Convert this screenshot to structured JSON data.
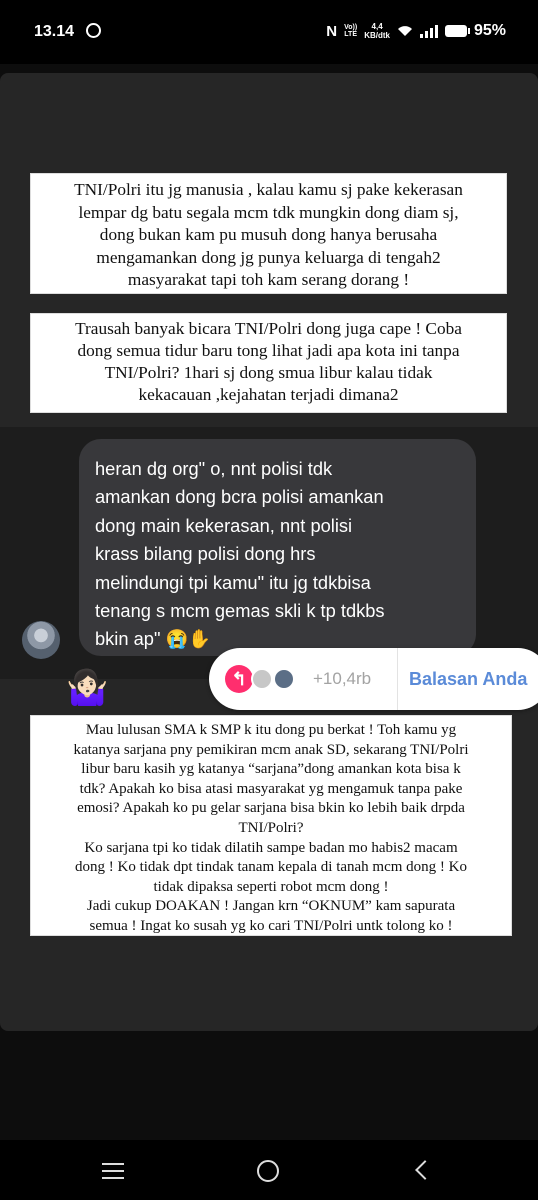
{
  "status": {
    "time": "13.14",
    "net_top": "Vo))",
    "net_bottom": "LTE",
    "speed_top": "4,4",
    "speed_bottom": "KB/dtk",
    "battery": "95%"
  },
  "quote1": {
    "lines": [
      "TNI/Polri itu jg manusia , kalau kamu sj pake kekerasan",
      "lempar dg batu segala mcm tdk mungkin dong diam sj,",
      "dong bukan kam pu musuh dong hanya berusaha",
      "mengamankan dong jg punya keluarga di tengah2",
      "masyarakat tapi toh kam serang dorang !"
    ]
  },
  "quote2": {
    "lines": [
      "Trausah banyak bicara TNI/Polri dong juga cape ! Coba",
      "dong semua tidur baru tong lihat jadi apa kota ini tanpa",
      "TNI/Polri? 1hari sj dong smua libur kalau tidak",
      "kekacauan ,kejahatan terjadi dimana2"
    ]
  },
  "message": {
    "lines": [
      "heran dg org\" o, nnt polisi tdk",
      "amankan dong bcra polisi amankan",
      "dong main kekerasan, nnt polisi",
      "krass bilang polisi dong hrs",
      "melindungi tpi kamu\" itu jg tdkbisa",
      "tenang s mcm gemas skli k tp tdkbs",
      "bkin ap\" 😭✋"
    ]
  },
  "reaction_emoji": "🤷🏻‍♀️",
  "reply_bar": {
    "arrow": "↰",
    "count": "+10,4rb",
    "label": "Balasan Anda"
  },
  "quote3": {
    "lines": [
      "Mau lulusan SMA k SMP k itu dong pu berkat ! Toh kamu yg",
      "katanya sarjana pny pemikiran mcm anak SD, sekarang TNI/Polri",
      "libur baru kasih yg katanya “sarjana”dong amankan kota bisa k",
      "tdk? Apakah ko bisa atasi masyarakat yg mengamuk tanpa pake",
      "emosi? Apakah ko pu gelar sarjana bisa bkin ko lebih baik drpda",
      "TNI/Polri?",
      "Ko sarjana tpi ko tidak dilatih sampe badan mo habis2 macam",
      "dong ! Ko tidak dpt tindak tanam kepala di tanah mcm dong ! Ko",
      "tidak dipaksa seperti robot mcm dong !",
      "Jadi cukup DOAKAN ! Jangan krn “OKNUM” kam sapurata",
      "semua ! Ingat ko susah yg ko cari TNI/Polri untk tolong ko !"
    ]
  }
}
